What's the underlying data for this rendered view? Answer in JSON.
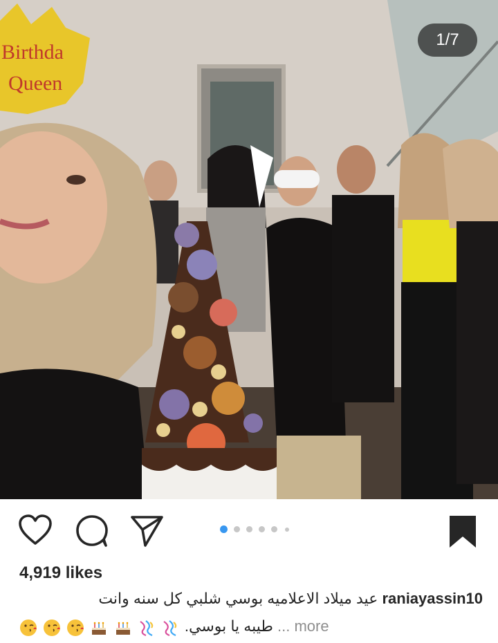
{
  "post": {
    "counter": "1/7",
    "balloon_text_line1": "Birthda",
    "balloon_text_line2": "Queen"
  },
  "actions": {
    "like_icon": "heart-icon",
    "comment_icon": "comment-icon",
    "share_icon": "share-icon",
    "save_icon": "bookmark-icon"
  },
  "carousel": {
    "count": 7,
    "active": 1
  },
  "likes": "4,919 likes",
  "caption": {
    "username": "raniayassin10",
    "line1_text": "عيد ميلاد الاعلاميه بوسي شلبي كل سنه وانت",
    "line2_text": "طيبه يا بوسي.",
    "more": "... more",
    "emojis": [
      "ribbon",
      "ribbon",
      "cake",
      "cake",
      "kiss-face",
      "kiss-face",
      "kiss-face"
    ]
  },
  "colors": {
    "accent_dot": "#3897f0",
    "text": "#262626",
    "muted": "#8e8e8e"
  }
}
